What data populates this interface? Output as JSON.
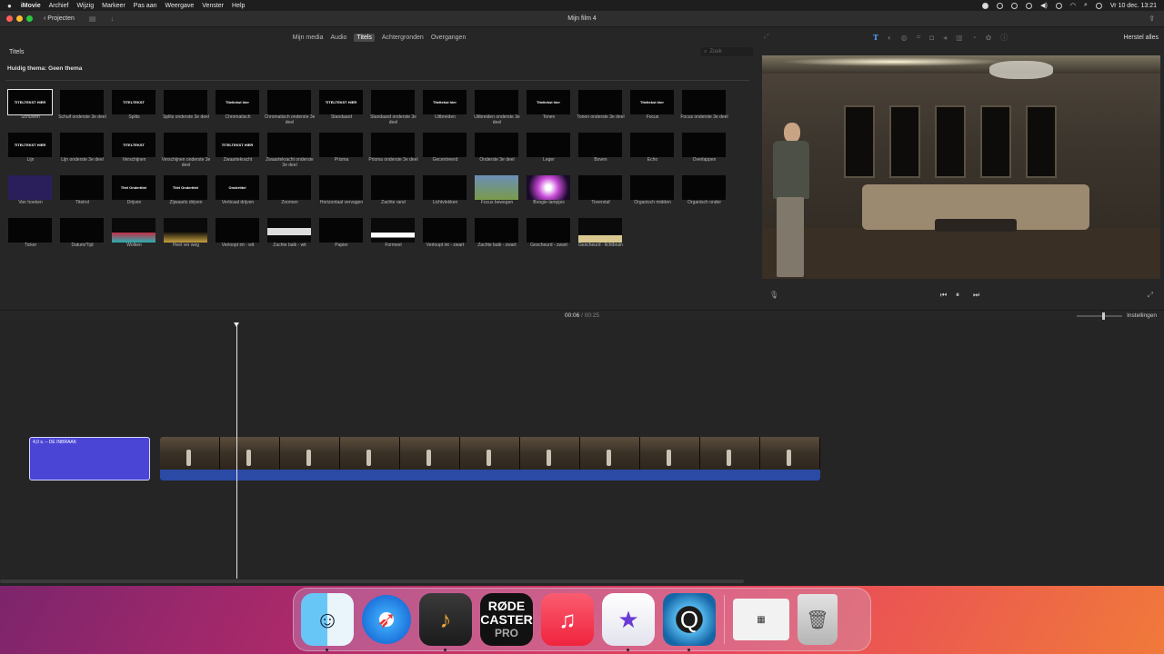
{
  "menubar": {
    "items": [
      "iMovie",
      "Archief",
      "Wijzig",
      "Markeer",
      "Pas aan",
      "Weergave",
      "Venster",
      "Help"
    ],
    "clock": "Vr 10 dec.  13:21"
  },
  "window": {
    "title": "Mijn film 4",
    "back_label": "Projecten"
  },
  "browser": {
    "tabs": [
      "Mijn media",
      "Audio",
      "Titels",
      "Achtergronden",
      "Overgangen"
    ],
    "active_tab": "Titels",
    "panel_title": "Titels",
    "search_placeholder": "Zoek",
    "theme_label": "Huidig thema: Geen thema"
  },
  "inspector": {
    "reset_label": "Herstel alles"
  },
  "titles": [
    {
      "name": "Schuiven",
      "preview": "TITELTEKST HIER",
      "selected": true
    },
    {
      "name": "Schuif onderste 3e deel",
      "preview": ""
    },
    {
      "name": "Splits",
      "preview": "TITELTEKST"
    },
    {
      "name": "Splits onderste 3e deel",
      "preview": ""
    },
    {
      "name": "Chromatisch",
      "preview": "Titeltekst hier"
    },
    {
      "name": "Chromatisch onderste 3e deel",
      "preview": ""
    },
    {
      "name": "Standaard",
      "preview": "TITELTEKST HIER"
    },
    {
      "name": "Standaard onderste 3e deel",
      "preview": ""
    },
    {
      "name": "Uitbreiden",
      "preview": "Titeltekst hier"
    },
    {
      "name": "Uitbreiden onderste 3e deel",
      "preview": ""
    },
    {
      "name": "Tonen",
      "preview": "Titeltekst hier"
    },
    {
      "name": "Tonen onderste 3e deel",
      "preview": ""
    },
    {
      "name": "Focus",
      "preview": "Titeltekst hier"
    },
    {
      "name": "Focus onderste 3e deel",
      "preview": ""
    },
    {
      "name": "Lijn",
      "preview": "TITELTEKST HIER"
    },
    {
      "name": "Lijn onderste 3e deel",
      "preview": ""
    },
    {
      "name": "Verschijnen",
      "preview": "TITELTEKST"
    },
    {
      "name": "Verschijnen onderste 3e deel",
      "preview": ""
    },
    {
      "name": "Zwaartekracht",
      "preview": "TITELTEKST HIER"
    },
    {
      "name": "Zwaartekracht onderste 3e deel",
      "preview": ""
    },
    {
      "name": "Prisma",
      "preview": ""
    },
    {
      "name": "Prisma onderste 3e deel",
      "preview": ""
    },
    {
      "name": "Gecentreerd",
      "preview": ""
    },
    {
      "name": "Onderste 3e deel",
      "preview": ""
    },
    {
      "name": "Leger",
      "preview": ""
    },
    {
      "name": "Boven",
      "preview": ""
    },
    {
      "name": "Echo",
      "preview": ""
    },
    {
      "name": "Overlappen",
      "preview": ""
    },
    {
      "name": "Vier hoeken",
      "preview": ""
    },
    {
      "name": "Titelrol",
      "preview": ""
    },
    {
      "name": "Drijven",
      "preview": "Titel Ondertitel"
    },
    {
      "name": "Zijwaarts drijven",
      "preview": "Titel Ondertitel"
    },
    {
      "name": "Verticaal drijven",
      "preview": "Ondertitel"
    },
    {
      "name": "Zoomen",
      "preview": ""
    },
    {
      "name": "Horizontaal vervagen",
      "preview": ""
    },
    {
      "name": "Zachte rand",
      "preview": ""
    },
    {
      "name": "Lichtvlekken",
      "preview": ""
    },
    {
      "name": "Focus bewegen",
      "preview": ""
    },
    {
      "name": "Boogie-lampjes",
      "preview": ""
    },
    {
      "name": "Toverstaf",
      "preview": ""
    },
    {
      "name": "Organisch midden",
      "preview": ""
    },
    {
      "name": "Organisch onder",
      "preview": ""
    },
    {
      "name": "Ticker",
      "preview": ""
    },
    {
      "name": "Datum/Tijd",
      "preview": ""
    },
    {
      "name": "Wolken",
      "preview": ""
    },
    {
      "name": "Heel ver weg",
      "preview": ""
    },
    {
      "name": "Verloopt int - wit",
      "preview": ""
    },
    {
      "name": "Zachte balk - wit",
      "preview": ""
    },
    {
      "name": "Papier",
      "preview": ""
    },
    {
      "name": "Formeel",
      "preview": ""
    },
    {
      "name": "Verloopt int - zwart",
      "preview": ""
    },
    {
      "name": "Zachte balk - zwart",
      "preview": ""
    },
    {
      "name": "Gescheurd - zwart",
      "preview": ""
    },
    {
      "name": "Gescheurd - lichtbruin",
      "preview": ""
    }
  ],
  "timeline": {
    "current_time": "00:06",
    "total_time": "00:25",
    "settings_label": "Instellingen",
    "title_clip_label": "4,0 s. – DE INBRAAK",
    "video_frames": 11
  }
}
